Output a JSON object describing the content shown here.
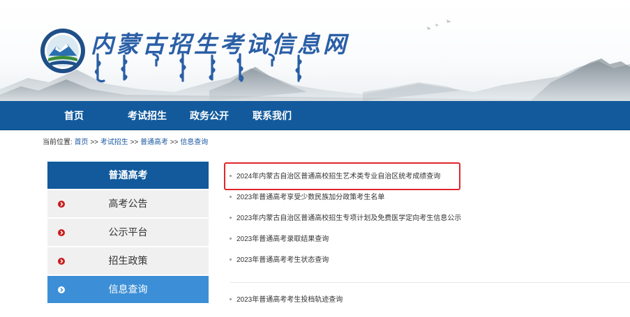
{
  "header": {
    "site_title": "内蒙古招生考试信息网",
    "colors": {
      "title": "#2a5fa6",
      "nav_bg": "#125a9c"
    }
  },
  "nav": {
    "items": [
      "首页",
      "考试招生",
      "政务公开",
      "联系我们"
    ]
  },
  "breadcrumb": {
    "prefix": "当前位置:",
    "items": [
      "首页",
      "考试招生",
      "普通高考",
      "信息查询"
    ],
    "separator": ">>"
  },
  "sidebar": {
    "heading": "普通高考",
    "items": [
      {
        "label": "高考公告",
        "icon": "chevron-right-icon"
      },
      {
        "label": "公示平台",
        "icon": "chevron-right-icon"
      },
      {
        "label": "招生政策",
        "icon": "chevron-right-icon"
      },
      {
        "label": "信息查询",
        "icon": "chevron-right-icon",
        "active": true
      }
    ],
    "colors": {
      "active_bg": "#3c8fd6",
      "bullet": "#c81a1a"
    }
  },
  "news": {
    "items": [
      "2024年内蒙古自治区普通高校招生艺术类专业自治区统考成绩查询",
      "2023年普通高考享受少数民族加分政策考生名单",
      "2023年内蒙古自治区普通高校招生专项计划及免费医学定向考生信息公示",
      "2023年普通高考录取结果查询",
      "2023年普通高考考生状态查询",
      "2023年普通高考考生投档轨迹查询"
    ],
    "highlight_color": "#e0262b"
  }
}
